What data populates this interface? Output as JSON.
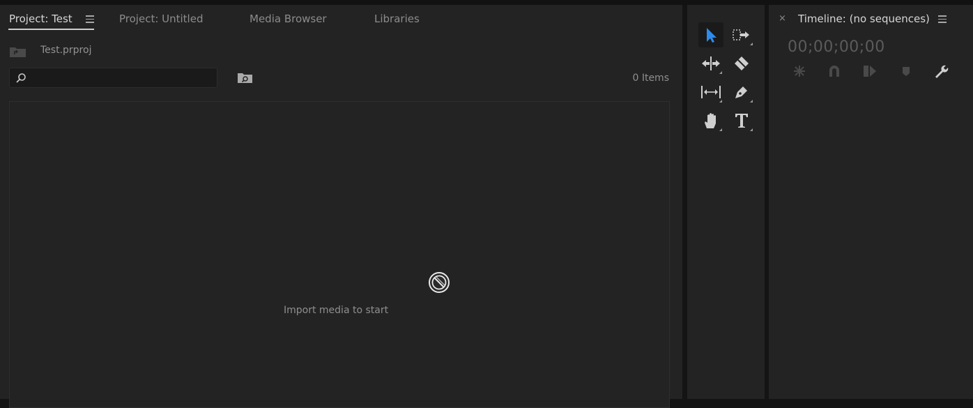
{
  "project_panel": {
    "tabs": [
      {
        "label": "Project: Test",
        "active": true
      },
      {
        "label": "Project: Untitled",
        "active": false
      },
      {
        "label": "Media Browser",
        "active": false
      },
      {
        "label": "Libraries",
        "active": false
      }
    ],
    "file_name": "Test.prproj",
    "search": {
      "value": "",
      "placeholder": ""
    },
    "items_count": "0 Items",
    "empty_message": "Import media to start"
  },
  "tools_panel": {
    "tools": [
      {
        "name": "selection-tool",
        "selected": true
      },
      {
        "name": "track-select-forward-tool",
        "selected": false
      },
      {
        "name": "ripple-edit-tool",
        "selected": false
      },
      {
        "name": "razor-tool",
        "selected": false
      },
      {
        "name": "slip-tool",
        "selected": false
      },
      {
        "name": "pen-tool",
        "selected": false
      },
      {
        "name": "hand-tool",
        "selected": false
      },
      {
        "name": "type-tool",
        "selected": false
      }
    ]
  },
  "timeline_panel": {
    "close_label": "×",
    "title": "Timeline: (no sequences)",
    "timecode": "00;00;00;00",
    "icons": [
      "nest-sequence-icon",
      "snap-magnet-icon",
      "linked-selection-icon",
      "add-marker-icon",
      "wrench-icon"
    ]
  },
  "colors": {
    "panel_bg": "#232323",
    "accent_blue": "#2d8ceb",
    "text_active": "#d6d6d6",
    "text_muted": "#8c8c8c"
  }
}
